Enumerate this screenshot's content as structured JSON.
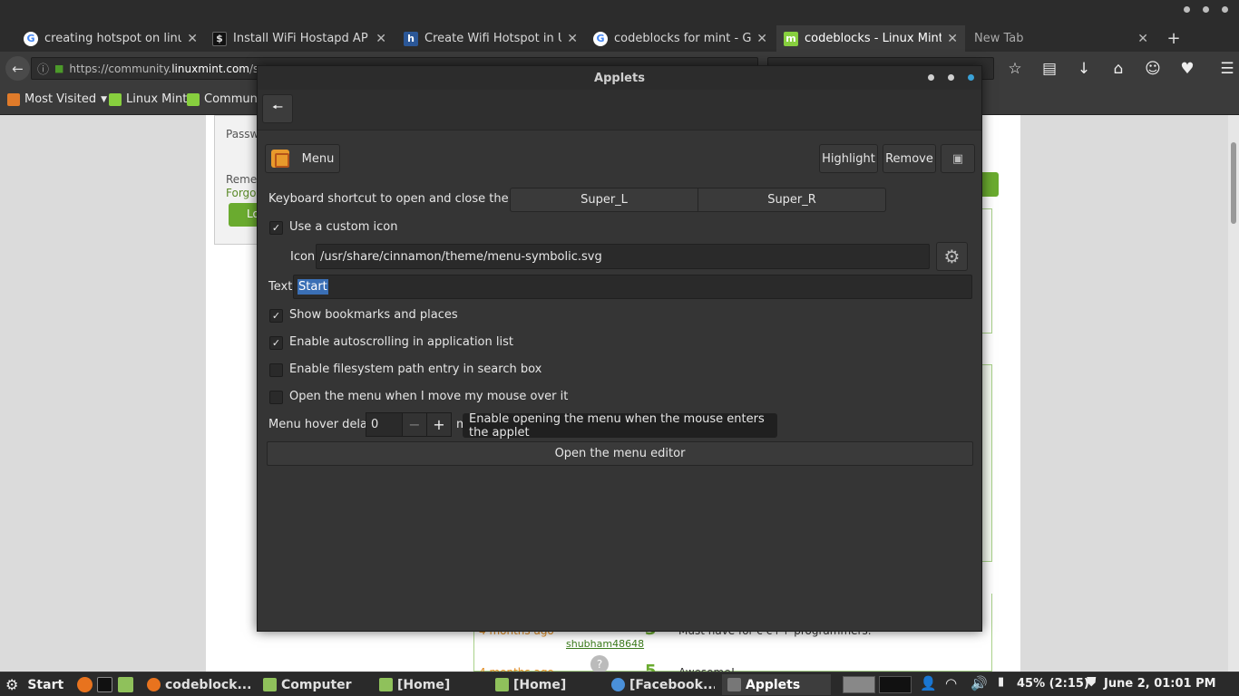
{
  "browser": {
    "tabs": [
      {
        "label": "creating hotspot on linux ...",
        "favicon": "google-g",
        "active": false
      },
      {
        "label": "Install WiFi Hostapd AP - ...",
        "favicon": "terminal-favicon",
        "active": false
      },
      {
        "label": "Create Wifi Hotspot in Ub...",
        "favicon": "h-favicon",
        "active": false
      },
      {
        "label": "codeblocks for mint - Go...",
        "favicon": "google-g",
        "active": false
      },
      {
        "label": "codeblocks - Linux Mint C...",
        "favicon": "mint-favicon",
        "active": true
      },
      {
        "label": "New Tab",
        "favicon": "",
        "active": false
      }
    ],
    "url_prefix": "https://community.",
    "url_domain": "linuxmint.com",
    "url_suffix": "/so",
    "bookmarks": {
      "most_visited": "Most Visited",
      "linux_mint": "Linux Mint",
      "community": "Community"
    }
  },
  "page": {
    "password_label": "Passw",
    "remember_label": "Reme",
    "forgot_label": "Forgo",
    "login_btn": "Lo",
    "comments": [
      {
        "time": "4 months ago",
        "user": "shubham48648",
        "score": "3",
        "text": "Must have for c c++ programmers."
      },
      {
        "time": "4 months ago",
        "score": "5",
        "text": "Awesome!"
      }
    ]
  },
  "dialog": {
    "title": "Applets",
    "applet_name": "Menu",
    "highlight": "Highlight",
    "remove": "Remove",
    "shortcut_label": "Keyboard shortcut to open and close the menu",
    "shortcut_1": "Super_L",
    "shortcut_2": "Super_R",
    "custom_icon_label": "Use a custom icon",
    "icon_label": "Icon",
    "icon_path": "/usr/share/cinnamon/theme/menu-symbolic.svg",
    "text_label": "Text",
    "text_value": "Start",
    "options": [
      {
        "label": "Show bookmarks and places",
        "checked": true
      },
      {
        "label": "Enable autoscrolling in application list",
        "checked": true
      },
      {
        "label": "Enable filesystem path entry in search box",
        "checked": false
      },
      {
        "label": "Open the menu when I move my mouse over it",
        "checked": false
      }
    ],
    "hover_delay_label": "Menu hover delay:",
    "hover_delay_value": "0",
    "hover_delay_unit": "m",
    "tooltip": "Enable opening the menu when the mouse enters the applet",
    "editor_btn": "Open the menu editor"
  },
  "panel": {
    "start": "Start",
    "tasks": [
      {
        "label": "codeblock...",
        "icon": "firefox-icon",
        "active": false
      },
      {
        "label": "Computer",
        "icon": "folder-icon",
        "active": false
      },
      {
        "label": "[Home]",
        "icon": "folder-icon",
        "active": false
      },
      {
        "label": "[Home]",
        "icon": "folder-icon",
        "active": false
      },
      {
        "label": "[Facebook...",
        "icon": "chrome-icon",
        "active": false
      },
      {
        "label": "Applets",
        "icon": "applets-icon",
        "active": true
      }
    ],
    "battery": "45% (2:15)",
    "clock": "June  2, 01:01 PM"
  }
}
